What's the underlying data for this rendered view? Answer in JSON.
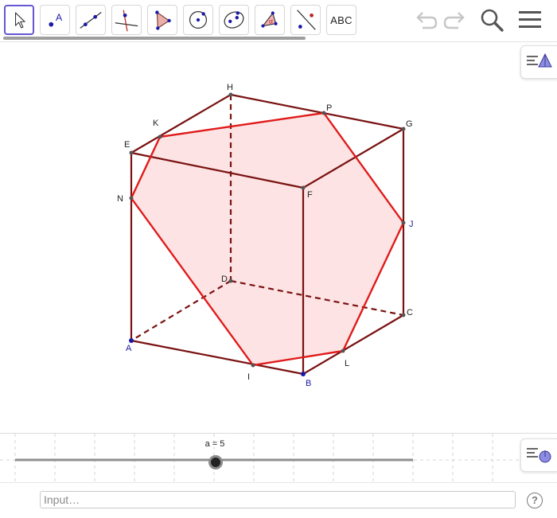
{
  "toolbar": {
    "tools": [
      {
        "name": "move",
        "icon": "cursor-arrow-icon",
        "active": true
      },
      {
        "name": "point",
        "icon": "point-icon",
        "label": "A"
      },
      {
        "name": "line",
        "icon": "line-through-points-icon"
      },
      {
        "name": "perpendicular-line",
        "icon": "perpendicular-line-icon"
      },
      {
        "name": "polygon",
        "icon": "polygon-icon"
      },
      {
        "name": "circle-center-point",
        "icon": "circle-with-center-icon"
      },
      {
        "name": "conic",
        "icon": "ellipse-icon"
      },
      {
        "name": "angle",
        "icon": "angle-icon",
        "label": "α"
      },
      {
        "name": "reflect",
        "icon": "reflect-about-line-icon"
      },
      {
        "name": "text",
        "icon": "text-icon",
        "label": "ABC"
      }
    ],
    "right_icons": [
      "undo-icon",
      "redo-icon",
      "search-icon",
      "menu-icon"
    ]
  },
  "graphics": {
    "point_labels": {
      "H": "H",
      "P": "P",
      "G": "G",
      "K": "K",
      "E": "E",
      "F": "F",
      "N": "N",
      "J": "J",
      "D": "D",
      "C": "C",
      "A": "A",
      "I": "I",
      "L": "L",
      "B": "B"
    },
    "colors": {
      "cube_edges": "#7a1212",
      "section_edges": "#e01b1b",
      "section_fill": "#fde3e3",
      "blue_points": "#1a1aa6"
    },
    "style_bar_icon": "graphics-style-icon"
  },
  "slider": {
    "label": "a = 5",
    "value": 5,
    "style_bar_icon": "slider-style-icon"
  },
  "input_bar": {
    "placeholder": "Input…",
    "value": "",
    "help_icon_label": "?"
  }
}
